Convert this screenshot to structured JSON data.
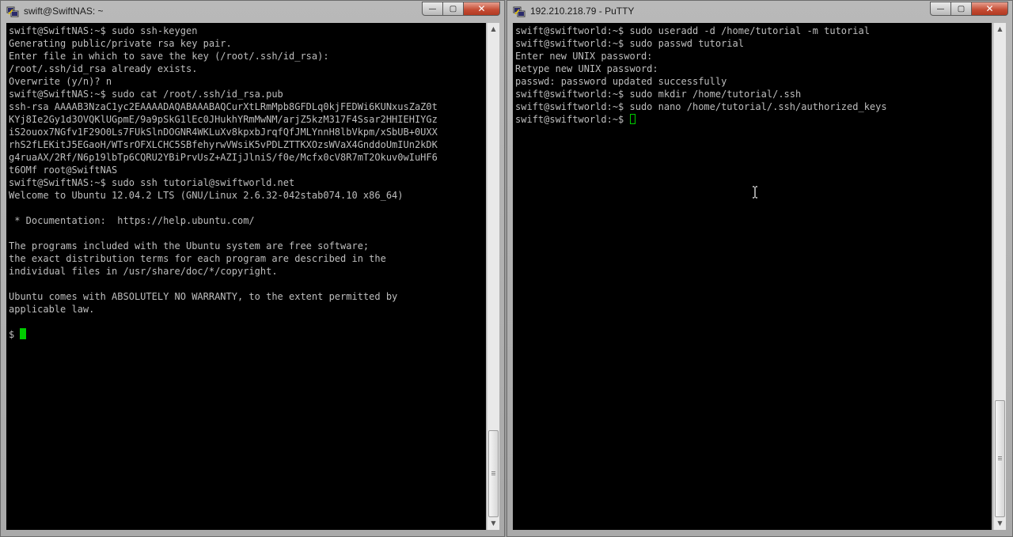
{
  "windows": {
    "left": {
      "title": "swift@SwiftNAS: ~",
      "icon": "putty-icon",
      "lines": [
        "swift@SwiftNAS:~$ sudo ssh-keygen",
        "Generating public/private rsa key pair.",
        "Enter file in which to save the key (/root/.ssh/id_rsa):",
        "/root/.ssh/id_rsa already exists.",
        "Overwrite (y/n)? n",
        "swift@SwiftNAS:~$ sudo cat /root/.ssh/id_rsa.pub",
        "ssh-rsa AAAAB3NzaC1yc2EAAAADAQABAAABAQCurXtLRmMpb8GFDLq0kjFEDWi6KUNxusZaZ0t",
        "KYj8Ie2Gy1d3OVQKlUGpmE/9a9pSkG1lEc0JHukhYRmMwNM/arjZ5kzM317F4Ssar2HHIEHIYGz",
        "iS2ouox7NGfv1F29O0Ls7FUkSlnDOGNR4WKLuXv8kpxbJrqfQfJMLYnnH8lbVkpm/xSbUB+0UXX",
        "rhS2fLEKitJ5EGaoH/WTsrOFXLCHC5SBfehyrwVWsiK5vPDLZTTKXOzsWVaX4GnddoUmIUn2kDK",
        "g4ruaAX/2Rf/N6p19lbTp6CQRU2YBiPrvUsZ+AZIjJlniS/f0e/Mcfx0cV8R7mT2Okuv0wIuHF6",
        "t6OMf root@SwiftNAS",
        "swift@SwiftNAS:~$ sudo ssh tutorial@swiftworld.net",
        "Welcome to Ubuntu 12.04.2 LTS (GNU/Linux 2.6.32-042stab074.10 x86_64)",
        "",
        " * Documentation:  https://help.ubuntu.com/",
        "",
        "The programs included with the Ubuntu system are free software;",
        "the exact distribution terms for each program are described in the",
        "individual files in /usr/share/doc/*/copyright.",
        "",
        "Ubuntu comes with ABSOLUTELY NO WARRANTY, to the extent permitted by",
        "applicable law.",
        ""
      ],
      "prompt": "$ "
    },
    "right": {
      "title": "192.210.218.79 - PuTTY",
      "icon": "putty-icon",
      "lines": [
        "swift@swiftworld:~$ sudo useradd -d /home/tutorial -m tutorial",
        "swift@swiftworld:~$ sudo passwd tutorial",
        "Enter new UNIX password:",
        "Retype new UNIX password:",
        "passwd: password updated successfully",
        "swift@swiftworld:~$ sudo mkdir /home/tutorial/.ssh",
        "swift@swiftworld:~$ sudo nano /home/tutorial/.ssh/authorized_keys"
      ],
      "prompt": "swift@swiftworld:~$ "
    }
  },
  "controls": {
    "minimize": "—",
    "maximize": "▢",
    "close": "✕",
    "scroll_up": "▲",
    "scroll_down": "▼"
  },
  "colors": {
    "terminal_bg": "#000000",
    "terminal_fg": "#bebebe",
    "cursor": "#00cc00",
    "close_button": "#c44a32"
  }
}
